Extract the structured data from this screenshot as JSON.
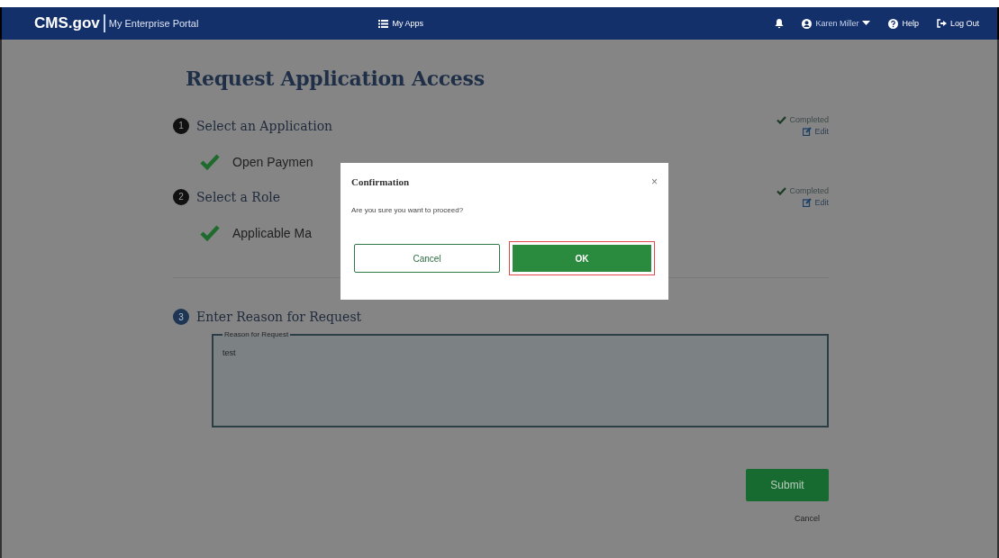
{
  "header": {
    "logo": "CMS.gov",
    "portal": "My Enterprise Portal",
    "apps": "My Apps",
    "user": "Karen Miller",
    "help": "Help",
    "logout": "Log Out"
  },
  "title": "Request Application Access",
  "steps": [
    {
      "number": "1",
      "title": "Select an Application",
      "completed": true,
      "status": "Completed",
      "edit": "Edit",
      "selection": "Open Paymen"
    },
    {
      "number": "2",
      "title": "Select a Role",
      "completed": true,
      "status": "Completed",
      "edit": "Edit",
      "selection": "Applicable Ma"
    },
    {
      "number": "3",
      "title": "Enter Reason for Request",
      "completed": false,
      "legend": "Reason for Request",
      "value": "test"
    }
  ],
  "submit": "Submit",
  "cancel": "Cancel",
  "dialog": {
    "title": "Confirmation",
    "close": "×",
    "message": "Are you sure you want to proceed?",
    "buttons": [
      {
        "label": "Cancel",
        "kind": "outline",
        "highlighted": false
      },
      {
        "label": "OK",
        "kind": "primary",
        "highlighted": true
      }
    ]
  }
}
